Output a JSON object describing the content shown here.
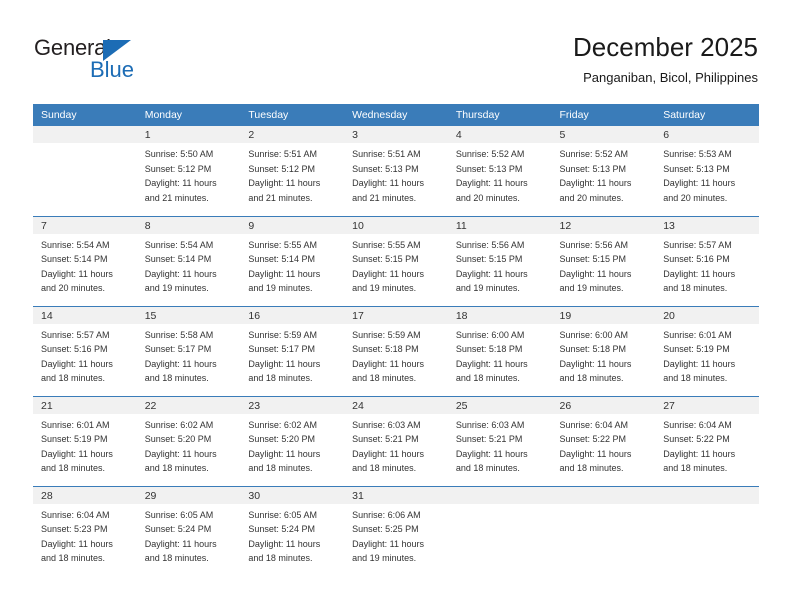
{
  "logo": {
    "text_top": "General",
    "text_bottom": "Blue",
    "triangle_icon": "blue-triangle-icon",
    "color_dark": "#231f20",
    "color_blue": "#1c6cb5"
  },
  "header": {
    "title": "December 2025",
    "subtitle": "Panganiban, Bicol, Philippines"
  },
  "colors": {
    "header_row": "#3a7cb9",
    "daynum_band": "#f1f1f1",
    "text": "#333333"
  },
  "weekday_headers": [
    "Sunday",
    "Monday",
    "Tuesday",
    "Wednesday",
    "Thursday",
    "Friday",
    "Saturday"
  ],
  "weeks": [
    [
      {
        "day": "",
        "sunrise": "",
        "sunset": "",
        "daylight_line1": "",
        "daylight_line2": ""
      },
      {
        "day": "1",
        "sunrise": "Sunrise: 5:50 AM",
        "sunset": "Sunset: 5:12 PM",
        "daylight_line1": "Daylight: 11 hours",
        "daylight_line2": "and 21 minutes."
      },
      {
        "day": "2",
        "sunrise": "Sunrise: 5:51 AM",
        "sunset": "Sunset: 5:12 PM",
        "daylight_line1": "Daylight: 11 hours",
        "daylight_line2": "and 21 minutes."
      },
      {
        "day": "3",
        "sunrise": "Sunrise: 5:51 AM",
        "sunset": "Sunset: 5:13 PM",
        "daylight_line1": "Daylight: 11 hours",
        "daylight_line2": "and 21 minutes."
      },
      {
        "day": "4",
        "sunrise": "Sunrise: 5:52 AM",
        "sunset": "Sunset: 5:13 PM",
        "daylight_line1": "Daylight: 11 hours",
        "daylight_line2": "and 20 minutes."
      },
      {
        "day": "5",
        "sunrise": "Sunrise: 5:52 AM",
        "sunset": "Sunset: 5:13 PM",
        "daylight_line1": "Daylight: 11 hours",
        "daylight_line2": "and 20 minutes."
      },
      {
        "day": "6",
        "sunrise": "Sunrise: 5:53 AM",
        "sunset": "Sunset: 5:13 PM",
        "daylight_line1": "Daylight: 11 hours",
        "daylight_line2": "and 20 minutes."
      }
    ],
    [
      {
        "day": "7",
        "sunrise": "Sunrise: 5:54 AM",
        "sunset": "Sunset: 5:14 PM",
        "daylight_line1": "Daylight: 11 hours",
        "daylight_line2": "and 20 minutes."
      },
      {
        "day": "8",
        "sunrise": "Sunrise: 5:54 AM",
        "sunset": "Sunset: 5:14 PM",
        "daylight_line1": "Daylight: 11 hours",
        "daylight_line2": "and 19 minutes."
      },
      {
        "day": "9",
        "sunrise": "Sunrise: 5:55 AM",
        "sunset": "Sunset: 5:14 PM",
        "daylight_line1": "Daylight: 11 hours",
        "daylight_line2": "and 19 minutes."
      },
      {
        "day": "10",
        "sunrise": "Sunrise: 5:55 AM",
        "sunset": "Sunset: 5:15 PM",
        "daylight_line1": "Daylight: 11 hours",
        "daylight_line2": "and 19 minutes."
      },
      {
        "day": "11",
        "sunrise": "Sunrise: 5:56 AM",
        "sunset": "Sunset: 5:15 PM",
        "daylight_line1": "Daylight: 11 hours",
        "daylight_line2": "and 19 minutes."
      },
      {
        "day": "12",
        "sunrise": "Sunrise: 5:56 AM",
        "sunset": "Sunset: 5:15 PM",
        "daylight_line1": "Daylight: 11 hours",
        "daylight_line2": "and 19 minutes."
      },
      {
        "day": "13",
        "sunrise": "Sunrise: 5:57 AM",
        "sunset": "Sunset: 5:16 PM",
        "daylight_line1": "Daylight: 11 hours",
        "daylight_line2": "and 18 minutes."
      }
    ],
    [
      {
        "day": "14",
        "sunrise": "Sunrise: 5:57 AM",
        "sunset": "Sunset: 5:16 PM",
        "daylight_line1": "Daylight: 11 hours",
        "daylight_line2": "and 18 minutes."
      },
      {
        "day": "15",
        "sunrise": "Sunrise: 5:58 AM",
        "sunset": "Sunset: 5:17 PM",
        "daylight_line1": "Daylight: 11 hours",
        "daylight_line2": "and 18 minutes."
      },
      {
        "day": "16",
        "sunrise": "Sunrise: 5:59 AM",
        "sunset": "Sunset: 5:17 PM",
        "daylight_line1": "Daylight: 11 hours",
        "daylight_line2": "and 18 minutes."
      },
      {
        "day": "17",
        "sunrise": "Sunrise: 5:59 AM",
        "sunset": "Sunset: 5:18 PM",
        "daylight_line1": "Daylight: 11 hours",
        "daylight_line2": "and 18 minutes."
      },
      {
        "day": "18",
        "sunrise": "Sunrise: 6:00 AM",
        "sunset": "Sunset: 5:18 PM",
        "daylight_line1": "Daylight: 11 hours",
        "daylight_line2": "and 18 minutes."
      },
      {
        "day": "19",
        "sunrise": "Sunrise: 6:00 AM",
        "sunset": "Sunset: 5:18 PM",
        "daylight_line1": "Daylight: 11 hours",
        "daylight_line2": "and 18 minutes."
      },
      {
        "day": "20",
        "sunrise": "Sunrise: 6:01 AM",
        "sunset": "Sunset: 5:19 PM",
        "daylight_line1": "Daylight: 11 hours",
        "daylight_line2": "and 18 minutes."
      }
    ],
    [
      {
        "day": "21",
        "sunrise": "Sunrise: 6:01 AM",
        "sunset": "Sunset: 5:19 PM",
        "daylight_line1": "Daylight: 11 hours",
        "daylight_line2": "and 18 minutes."
      },
      {
        "day": "22",
        "sunrise": "Sunrise: 6:02 AM",
        "sunset": "Sunset: 5:20 PM",
        "daylight_line1": "Daylight: 11 hours",
        "daylight_line2": "and 18 minutes."
      },
      {
        "day": "23",
        "sunrise": "Sunrise: 6:02 AM",
        "sunset": "Sunset: 5:20 PM",
        "daylight_line1": "Daylight: 11 hours",
        "daylight_line2": "and 18 minutes."
      },
      {
        "day": "24",
        "sunrise": "Sunrise: 6:03 AM",
        "sunset": "Sunset: 5:21 PM",
        "daylight_line1": "Daylight: 11 hours",
        "daylight_line2": "and 18 minutes."
      },
      {
        "day": "25",
        "sunrise": "Sunrise: 6:03 AM",
        "sunset": "Sunset: 5:21 PM",
        "daylight_line1": "Daylight: 11 hours",
        "daylight_line2": "and 18 minutes."
      },
      {
        "day": "26",
        "sunrise": "Sunrise: 6:04 AM",
        "sunset": "Sunset: 5:22 PM",
        "daylight_line1": "Daylight: 11 hours",
        "daylight_line2": "and 18 minutes."
      },
      {
        "day": "27",
        "sunrise": "Sunrise: 6:04 AM",
        "sunset": "Sunset: 5:22 PM",
        "daylight_line1": "Daylight: 11 hours",
        "daylight_line2": "and 18 minutes."
      }
    ],
    [
      {
        "day": "28",
        "sunrise": "Sunrise: 6:04 AM",
        "sunset": "Sunset: 5:23 PM",
        "daylight_line1": "Daylight: 11 hours",
        "daylight_line2": "and 18 minutes."
      },
      {
        "day": "29",
        "sunrise": "Sunrise: 6:05 AM",
        "sunset": "Sunset: 5:24 PM",
        "daylight_line1": "Daylight: 11 hours",
        "daylight_line2": "and 18 minutes."
      },
      {
        "day": "30",
        "sunrise": "Sunrise: 6:05 AM",
        "sunset": "Sunset: 5:24 PM",
        "daylight_line1": "Daylight: 11 hours",
        "daylight_line2": "and 18 minutes."
      },
      {
        "day": "31",
        "sunrise": "Sunrise: 6:06 AM",
        "sunset": "Sunset: 5:25 PM",
        "daylight_line1": "Daylight: 11 hours",
        "daylight_line2": "and 19 minutes."
      },
      {
        "day": "",
        "sunrise": "",
        "sunset": "",
        "daylight_line1": "",
        "daylight_line2": ""
      },
      {
        "day": "",
        "sunrise": "",
        "sunset": "",
        "daylight_line1": "",
        "daylight_line2": ""
      },
      {
        "day": "",
        "sunrise": "",
        "sunset": "",
        "daylight_line1": "",
        "daylight_line2": ""
      }
    ]
  ]
}
